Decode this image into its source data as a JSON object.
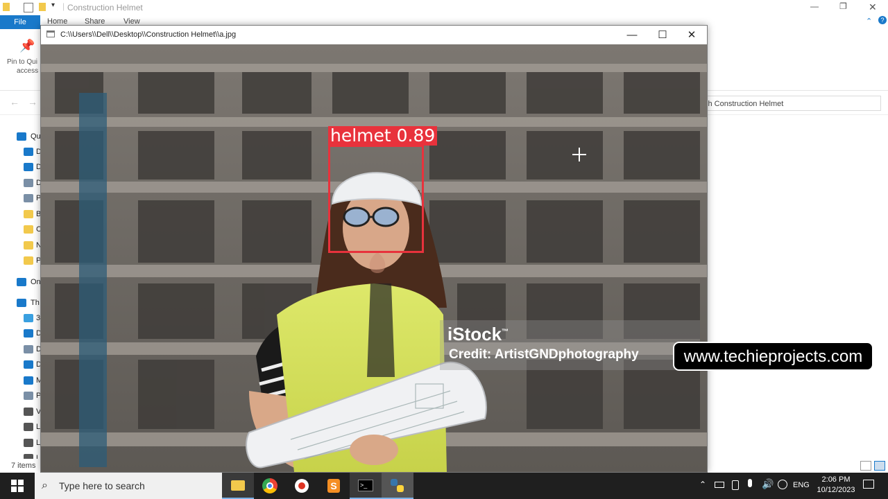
{
  "explorer": {
    "title": "Construction Helmet",
    "tabs": [
      "File",
      "Home",
      "Share",
      "View"
    ],
    "ribbon_pin_label_line1": "Pin to Qui",
    "ribbon_pin_label_line2": "access",
    "search_placeholder": "ch Construction Helmet",
    "nav_items": [
      {
        "label": "Qu",
        "icon": "star-icon",
        "color": "#1979ca"
      },
      {
        "label": "D",
        "icon": "desktop-icon",
        "color": "#1979ca"
      },
      {
        "label": "D",
        "icon": "download-icon",
        "color": "#1979ca"
      },
      {
        "label": "D",
        "icon": "document-icon",
        "color": "#7a8fa6"
      },
      {
        "label": "P",
        "icon": "pictures-icon",
        "color": "#7a8fa6"
      },
      {
        "label": "B",
        "icon": "folder-icon",
        "color": "#f2c94c"
      },
      {
        "label": "C",
        "icon": "folder-icon",
        "color": "#f2c94c"
      },
      {
        "label": "N",
        "icon": "folder-icon",
        "color": "#f2c94c"
      },
      {
        "label": "P",
        "icon": "folder-icon",
        "color": "#f2c94c"
      },
      {
        "label": "On",
        "icon": "onedrive-icon",
        "color": "#1979ca"
      },
      {
        "label": "Th",
        "icon": "thispc-icon",
        "color": "#1979ca"
      },
      {
        "label": "3",
        "icon": "objects3d-icon",
        "color": "#3aa0e0"
      },
      {
        "label": "D",
        "icon": "desktop-icon",
        "color": "#1979ca"
      },
      {
        "label": "D",
        "icon": "document-icon",
        "color": "#7a8fa6"
      },
      {
        "label": "D",
        "icon": "download-icon",
        "color": "#1979ca"
      },
      {
        "label": "M",
        "icon": "music-icon",
        "color": "#1979ca"
      },
      {
        "label": "P",
        "icon": "pictures-icon",
        "color": "#7a8fa6"
      },
      {
        "label": "V",
        "icon": "videos-icon",
        "color": "#555"
      },
      {
        "label": "L",
        "icon": "drive-icon",
        "color": "#555"
      },
      {
        "label": "L",
        "icon": "drive-icon",
        "color": "#555"
      },
      {
        "label": "L",
        "icon": "drive-icon",
        "color": "#555"
      }
    ],
    "status_text": "7 items"
  },
  "image_window": {
    "title": "C:\\\\Users\\\\Dell\\\\Desktop\\\\Construction Helmet\\\\a.jpg",
    "minimize": "—",
    "maximize": "☐",
    "close": "✕"
  },
  "detection": {
    "label": "helmet 0.89",
    "color": "#e8323c"
  },
  "watermark": {
    "brand": "iStock",
    "brand_mark": "™",
    "credit": "Credit: ArtistGNDphotography"
  },
  "site_badge": "www.techieprojects.com",
  "taskbar": {
    "search_placeholder": "Type here to search",
    "language": "ENG",
    "time": "2:06 PM",
    "date": "10/12/2023"
  }
}
